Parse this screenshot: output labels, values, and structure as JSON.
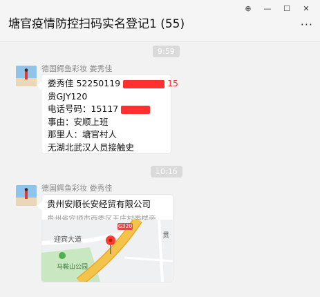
{
  "window": {
    "title": "塘官疫情防控扫码实名登记1 (55)",
    "controls": {
      "pin": "⊕",
      "minimize": "—",
      "maximize": "☐",
      "close": "✕"
    },
    "more": "···"
  },
  "messages": [
    {
      "time": "9:59",
      "sender": "德国鳄鱼彩妆   娄秀佳",
      "lines": [
        "娄秀佳  52250119",
        "贵GJY120",
        "电话号码：15117",
        "事由：安顺上班",
        "那里人：塘官村人",
        "无湖北武汉人员接触史"
      ],
      "id_tail": "15"
    },
    {
      "time": "10:16",
      "sender": "德国鳄鱼彩妆   娄秀佳",
      "location": {
        "title": "贵州安顺长安经贸有限公司",
        "address": "贵州省安顺市西秀区王庄村委楼旁",
        "map_labels": {
          "road": "迎宾大道",
          "highway": "G320",
          "park": "马鞍山公园",
          "corner": "贯"
        }
      }
    }
  ],
  "colors": {
    "road_main": "#f3c34a",
    "map_bg": "#eef0f2",
    "park_green": "#c9e7c0",
    "pin": "#ff3b30",
    "redact": "#ff3030"
  }
}
